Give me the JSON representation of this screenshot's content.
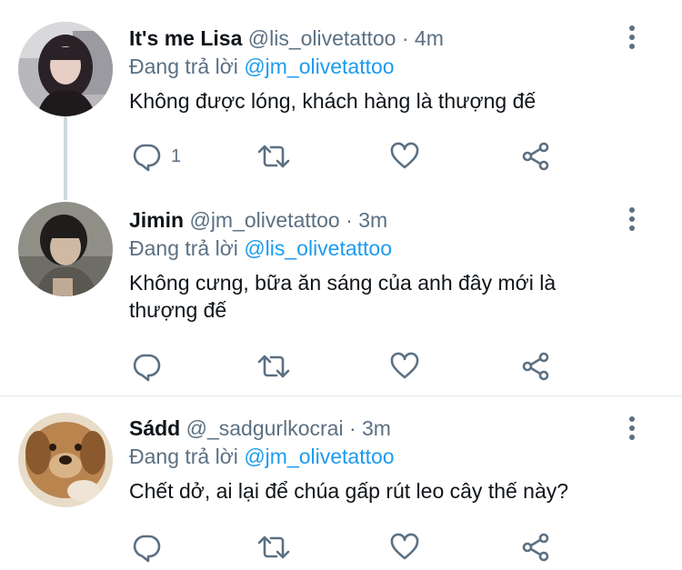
{
  "tweets": [
    {
      "name": "It's me Lisa",
      "handle": "@lis_olivetattoo",
      "time": "4m",
      "replying_prefix": "Đang trả lời",
      "replying_to": "@jm_olivetattoo",
      "text": "Không được lóng, khách hàng là thượng đế",
      "reply_count": "1"
    },
    {
      "name": "Jimin",
      "handle": "@jm_olivetattoo",
      "time": "3m",
      "replying_prefix": "Đang trả lời",
      "replying_to": "@lis_olivetattoo",
      "text": "Không cưng, bữa ăn sáng của anh đây mới là thượng đế",
      "reply_count": ""
    },
    {
      "name": "Sádd",
      "handle": "@_sadgurlkocrai",
      "time": "3m",
      "replying_prefix": "Đang trả lời",
      "replying_to": "@jm_olivetattoo",
      "text": "Chết dở, ai lại để chúa gấp rút leo cây thế này?",
      "reply_count": ""
    }
  ],
  "separator": "·",
  "colors": {
    "secondary": "#5b7083",
    "link": "#1d9bf0",
    "primary": "#0f1419",
    "divider": "#e1e8ed"
  },
  "icons": [
    "reply-icon",
    "retweet-icon",
    "like-icon",
    "share-icon",
    "more-icon"
  ]
}
